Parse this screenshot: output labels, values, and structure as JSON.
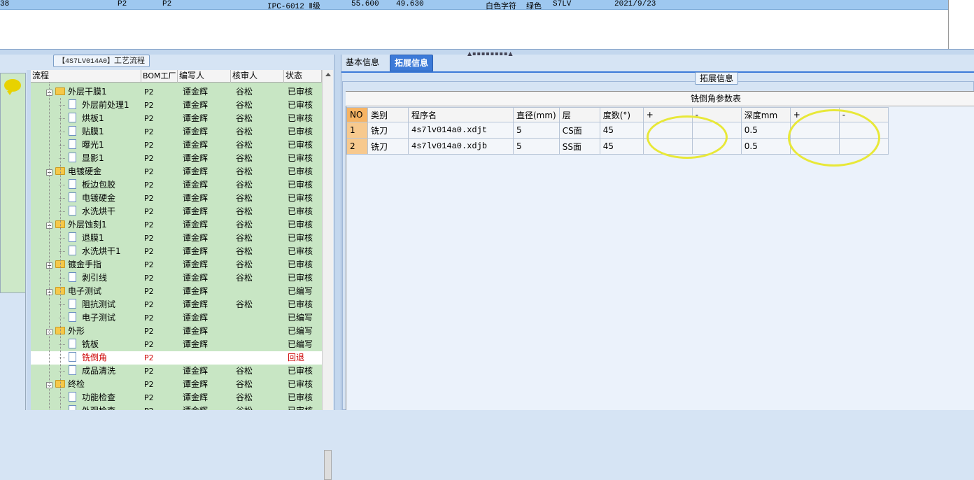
{
  "top_grid": {
    "row": [
      "38",
      "P2",
      "P2",
      "IPC-6012 Ⅱ级",
      "55.600",
      "49.630",
      "白色字符",
      "绿色",
      "S7LV",
      "2021/9/23"
    ]
  },
  "left_panel": {
    "title_code": "【4S7LV014A0】",
    "title_text": "工艺流程",
    "columns": [
      "流程",
      "BOM工厂",
      "编写人",
      "核审人",
      "状态"
    ],
    "rows": [
      {
        "name": "外层干膜1",
        "level": 0,
        "bom": "P2",
        "writer": "谭金辉",
        "reviewer": "谷松",
        "status": "已审核"
      },
      {
        "name": "外层前处理1",
        "level": 1,
        "bom": "P2",
        "writer": "谭金辉",
        "reviewer": "谷松",
        "status": "已审核"
      },
      {
        "name": "烘板1",
        "level": 1,
        "bom": "P2",
        "writer": "谭金辉",
        "reviewer": "谷松",
        "status": "已审核"
      },
      {
        "name": "贴膜1",
        "level": 1,
        "bom": "P2",
        "writer": "谭金辉",
        "reviewer": "谷松",
        "status": "已审核"
      },
      {
        "name": "曝光1",
        "level": 1,
        "bom": "P2",
        "writer": "谭金辉",
        "reviewer": "谷松",
        "status": "已审核"
      },
      {
        "name": "显影1",
        "level": 1,
        "bom": "P2",
        "writer": "谭金辉",
        "reviewer": "谷松",
        "status": "已审核"
      },
      {
        "name": "电镀硬金",
        "level": 0,
        "bom": "P2",
        "writer": "谭金辉",
        "reviewer": "谷松",
        "status": "已审核"
      },
      {
        "name": "板边包胶",
        "level": 1,
        "bom": "P2",
        "writer": "谭金辉",
        "reviewer": "谷松",
        "status": "已审核"
      },
      {
        "name": "电镀硬金",
        "level": 1,
        "bom": "P2",
        "writer": "谭金辉",
        "reviewer": "谷松",
        "status": "已审核"
      },
      {
        "name": "水洗烘干",
        "level": 1,
        "bom": "P2",
        "writer": "谭金辉",
        "reviewer": "谷松",
        "status": "已审核"
      },
      {
        "name": "外层蚀刻1",
        "level": 0,
        "bom": "P2",
        "writer": "谭金辉",
        "reviewer": "谷松",
        "status": "已审核"
      },
      {
        "name": "退膜1",
        "level": 1,
        "bom": "P2",
        "writer": "谭金辉",
        "reviewer": "谷松",
        "status": "已审核"
      },
      {
        "name": "水洗烘干1",
        "level": 1,
        "bom": "P2",
        "writer": "谭金辉",
        "reviewer": "谷松",
        "status": "已审核"
      },
      {
        "name": "镀金手指",
        "level": 0,
        "bom": "P2",
        "writer": "谭金辉",
        "reviewer": "谷松",
        "status": "已审核"
      },
      {
        "name": "剥引线",
        "level": 1,
        "bom": "P2",
        "writer": "谭金辉",
        "reviewer": "谷松",
        "status": "已审核"
      },
      {
        "name": "电子测试",
        "level": 0,
        "bom": "P2",
        "writer": "谭金辉",
        "reviewer": "",
        "status": "已编写"
      },
      {
        "name": "阻抗测试",
        "level": 1,
        "bom": "P2",
        "writer": "谭金辉",
        "reviewer": "谷松",
        "status": "已审核"
      },
      {
        "name": "电子测试",
        "level": 1,
        "bom": "P2",
        "writer": "谭金辉",
        "reviewer": "",
        "status": "已编写"
      },
      {
        "name": "外形",
        "level": 0,
        "bom": "P2",
        "writer": "谭金辉",
        "reviewer": "",
        "status": "已编写"
      },
      {
        "name": "铣板",
        "level": 1,
        "bom": "P2",
        "writer": "谭金辉",
        "reviewer": "",
        "status": "已编写"
      },
      {
        "name": "铣倒角",
        "level": 1,
        "bom": "P2",
        "writer": "",
        "reviewer": "",
        "status": "回退",
        "selected": true
      },
      {
        "name": "成品清洗",
        "level": 1,
        "bom": "P2",
        "writer": "谭金辉",
        "reviewer": "谷松",
        "status": "已审核"
      },
      {
        "name": "终检",
        "level": 0,
        "bom": "P2",
        "writer": "谭金辉",
        "reviewer": "谷松",
        "status": "已审核"
      },
      {
        "name": "功能检查",
        "level": 1,
        "bom": "P2",
        "writer": "谭金辉",
        "reviewer": "谷松",
        "status": "已审核"
      },
      {
        "name": "外观检查",
        "level": 1,
        "bom": "P2",
        "writer": "谭金辉",
        "reviewer": "谷松",
        "status": "已审核"
      }
    ]
  },
  "right_panel": {
    "tabs": [
      "基本信息",
      "拓展信息"
    ],
    "active_tab": "拓展信息",
    "group_legend": "拓展信息",
    "table_title": "铣倒角参数表",
    "columns": [
      "NO",
      "类别",
      "程序名",
      "直径(mm)",
      "层",
      "度数(°)",
      "+",
      "-",
      "深度mm",
      "+",
      "-"
    ],
    "rows": [
      [
        "1",
        "铣刀",
        "4s7lv014a0.xdjt",
        "5",
        "CS面",
        "45",
        "",
        "",
        "0.5",
        "",
        ""
      ],
      [
        "2",
        "铣刀",
        "4s7lv014a0.xdjb",
        "5",
        "SS面",
        "45",
        "",
        "",
        "0.5",
        "",
        ""
      ]
    ]
  },
  "colors": {
    "tab_active": "#3c7ad8",
    "tree_bg": "#c8e6c4",
    "highlight_ellipse": "#e8e838",
    "rollback_text": "#cc0000"
  }
}
